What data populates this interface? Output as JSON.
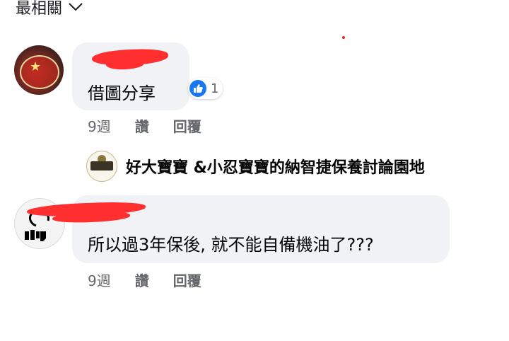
{
  "sort": {
    "label": "最相關",
    "icon": "chevron-down-icon"
  },
  "comments": [
    {
      "text": "借圖分享",
      "reaction": {
        "icon": "like-icon",
        "count": "1"
      },
      "time": "9週",
      "like_label": "讚",
      "reply_label": "回覆"
    },
    {
      "text": "所以過3年保後, 就不能自備機油了???",
      "time": "9週",
      "like_label": "讚",
      "reply_label": "回覆"
    }
  ],
  "reply_by": {
    "name": "好大寶寶 &小忍寶寶的納智捷保養討論園地"
  },
  "colors": {
    "bubble": "#f0f2f5",
    "meta_text": "#65676b",
    "like_blue": "#1877f2",
    "redaction": "#ff2f2f"
  }
}
